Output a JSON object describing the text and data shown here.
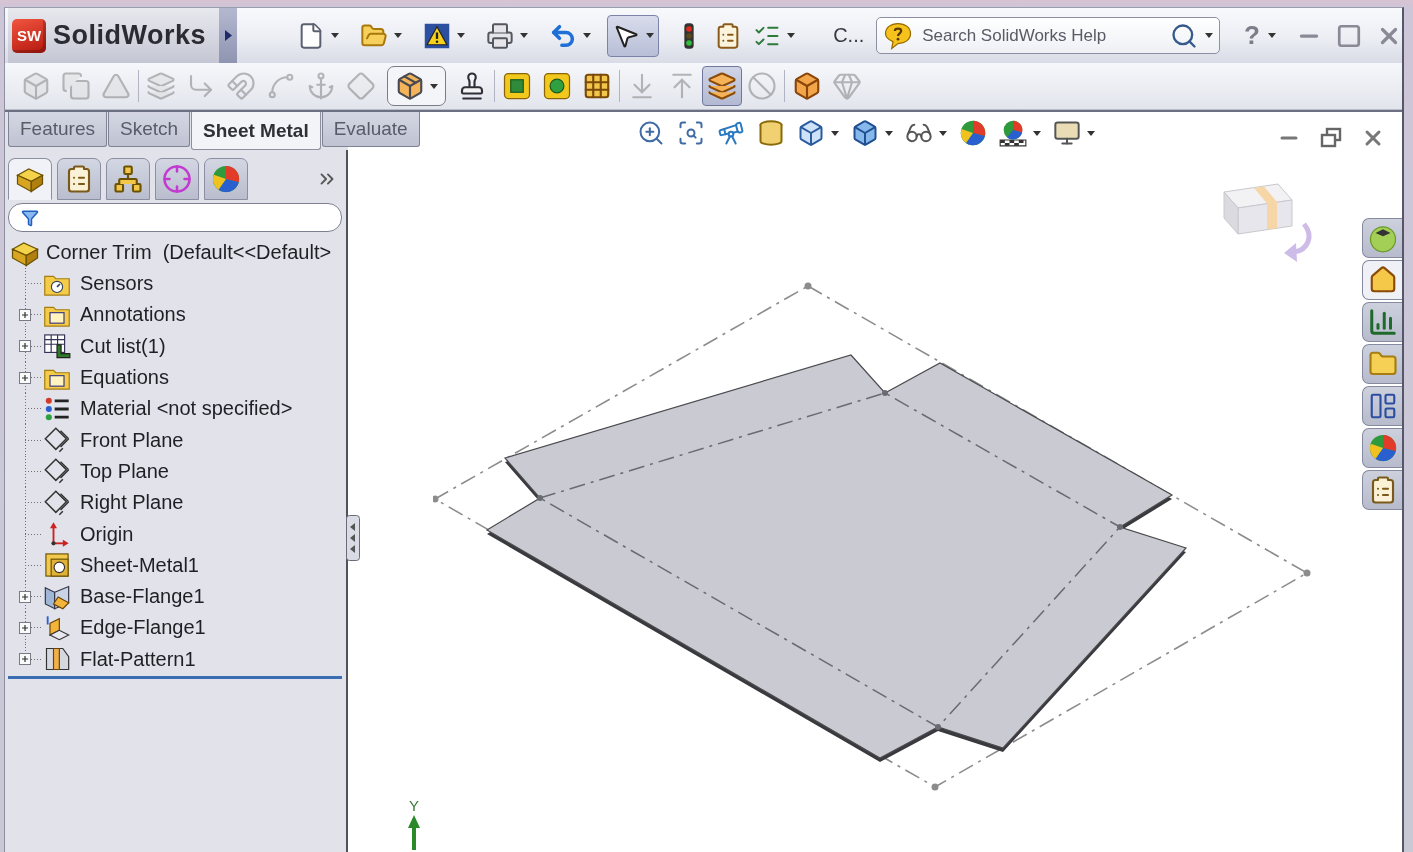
{
  "title_bar": {
    "logo_mark": "SW",
    "logo": "SolidWorks",
    "tools": [
      {
        "kind": "new",
        "menu": true,
        "selected": false
      },
      {
        "kind": "open",
        "menu": true,
        "selected": false
      },
      {
        "kind": "rebuild",
        "menu": true,
        "selected": false
      },
      {
        "kind": "print",
        "menu": true,
        "selected": false
      },
      {
        "kind": "undo",
        "menu": true,
        "selected": false
      },
      {
        "kind": "select",
        "menu": true,
        "selected": true
      },
      {
        "kind": "traffic",
        "menu": false,
        "selected": false
      },
      {
        "kind": "options",
        "menu": false,
        "selected": false
      },
      {
        "kind": "checklist",
        "menu": true,
        "selected": false
      }
    ],
    "overflow_label": "C...",
    "search": {
      "placeholder": "Search SolidWorks Help"
    },
    "help": {
      "label": "?",
      "menu": true
    }
  },
  "command_manager": {
    "groups": [
      {
        "tools": [
          {
            "kind": "box",
            "disabled": true,
            "selected": false,
            "menu": false
          },
          {
            "kind": "copy",
            "disabled": true,
            "selected": false,
            "menu": false
          },
          {
            "kind": "triangle",
            "disabled": true,
            "selected": false,
            "menu": false
          }
        ]
      },
      {
        "tools": [
          {
            "kind": "layers",
            "disabled": true,
            "selected": false,
            "menu": false
          },
          {
            "kind": "corner",
            "disabled": true,
            "selected": false,
            "menu": false
          },
          {
            "kind": "magnet",
            "disabled": true,
            "selected": false,
            "menu": false
          },
          {
            "kind": "curve",
            "disabled": true,
            "selected": false,
            "menu": false
          },
          {
            "kind": "anchor",
            "disabled": true,
            "selected": false,
            "menu": false
          },
          {
            "kind": "diamond",
            "disabled": true,
            "selected": false,
            "menu": false
          },
          {
            "kind": "package",
            "disabled": false,
            "selected": false,
            "menu": true
          },
          {
            "kind": "stamp",
            "disabled": false,
            "selected": false,
            "menu": false
          }
        ]
      },
      {
        "tools": [
          {
            "kind": "tilesquare",
            "disabled": false,
            "selected": false,
            "menu": false
          },
          {
            "kind": "tilecircle",
            "disabled": false,
            "selected": false,
            "menu": false
          },
          {
            "kind": "grid",
            "disabled": false,
            "selected": false,
            "menu": false
          }
        ]
      },
      {
        "tools": [
          {
            "kind": "arrowdown",
            "disabled": true,
            "selected": false,
            "menu": false
          },
          {
            "kind": "arrowup",
            "disabled": true,
            "selected": false,
            "menu": false
          },
          {
            "kind": "stack",
            "disabled": false,
            "selected": true,
            "menu": false
          },
          {
            "kind": "ban",
            "disabled": true,
            "selected": false,
            "menu": false
          }
        ]
      },
      {
        "tools": [
          {
            "kind": "cube",
            "disabled": false,
            "selected": false,
            "menu": false
          },
          {
            "kind": "gem",
            "disabled": true,
            "selected": false,
            "menu": false
          }
        ]
      }
    ]
  },
  "tabs": [
    {
      "label": "Features",
      "selected": false
    },
    {
      "label": "Sketch",
      "selected": false
    },
    {
      "label": "Sheet Metal",
      "selected": true
    },
    {
      "label": "Evaluate",
      "selected": false
    }
  ],
  "view_toolbar": [
    {
      "kind": "zoomfit",
      "menu": false
    },
    {
      "kind": "zoomarea",
      "menu": false
    },
    {
      "kind": "previous",
      "menu": false
    },
    {
      "kind": "section",
      "menu": false
    },
    {
      "kind": "orientation",
      "menu": true
    },
    {
      "kind": "display",
      "menu": true
    },
    {
      "kind": "glasses",
      "menu": true
    },
    {
      "kind": "appearance",
      "menu": false
    },
    {
      "kind": "scene",
      "menu": true
    },
    {
      "kind": "monitor",
      "menu": true
    }
  ],
  "panel_tabs": [
    {
      "kind": "part",
      "selected": true
    },
    {
      "kind": "property",
      "selected": false
    },
    {
      "kind": "config",
      "selected": false
    },
    {
      "kind": "crosshair",
      "selected": false
    },
    {
      "kind": "display",
      "selected": false
    }
  ],
  "feature_tree": {
    "root": {
      "label": "Corner Trim  (Default<<Default>",
      "children": [
        {
          "label": "Sensors",
          "kind": "sensors",
          "expandable": false
        },
        {
          "label": "Annotations",
          "kind": "annotations",
          "expandable": true
        },
        {
          "label": "Cut list(1)",
          "kind": "cutlist",
          "expandable": true
        },
        {
          "label": "Equations",
          "kind": "equations",
          "expandable": true
        },
        {
          "label": "Material <not specified>",
          "kind": "material",
          "expandable": false
        },
        {
          "label": "Front Plane",
          "kind": "plane",
          "expandable": false
        },
        {
          "label": "Top Plane",
          "kind": "plane",
          "expandable": false
        },
        {
          "label": "Right Plane",
          "kind": "plane",
          "expandable": false
        },
        {
          "label": "Origin",
          "kind": "origin",
          "expandable": false
        },
        {
          "label": "Sheet-Metal1",
          "kind": "sheetmetal",
          "expandable": false
        },
        {
          "label": "Base-Flange1",
          "kind": "baseflange",
          "expandable": true
        },
        {
          "label": "Edge-Flange1",
          "kind": "edgeflange",
          "expandable": true
        },
        {
          "label": "Flat-Pattern1",
          "kind": "flatpattern",
          "expandable": true
        }
      ]
    }
  },
  "task_pane": [
    {
      "kind": "resources",
      "selected": false
    },
    {
      "kind": "home",
      "selected": true
    },
    {
      "kind": "chart",
      "selected": false
    },
    {
      "kind": "folder",
      "selected": false
    },
    {
      "kind": "palette",
      "selected": false
    },
    {
      "kind": "appearance",
      "selected": false
    },
    {
      "kind": "properties",
      "selected": false
    }
  ],
  "triad": {
    "label": "Y"
  }
}
